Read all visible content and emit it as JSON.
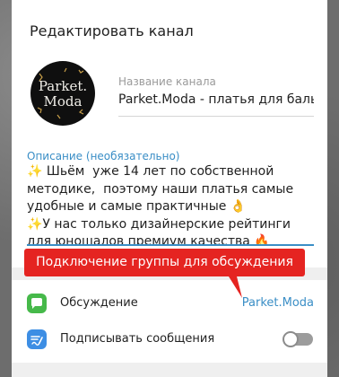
{
  "dialog": {
    "title": "Редактировать канал"
  },
  "channel": {
    "avatar_text_line1": "Parket.",
    "avatar_text_line2": "Moda",
    "name_label": "Название канала",
    "name_value": "Parket.Moda - платья для бальн"
  },
  "description": {
    "label": "Описание (необязательно)",
    "text": "✨ Шьём  уже 14 лет по собственной методике,  поэтому наши платья самые удобные и самые практичные 👌\n✨У нас только дизайнерские рейтинги для юношалов премиум качества 🔥"
  },
  "annotation": {
    "callout_text": "Подключение группы для обсуждения",
    "color": "#e52421"
  },
  "settings": {
    "discussion": {
      "label": "Обсуждение",
      "value": "Parket.Moda",
      "icon": "chat-bubble-icon",
      "icon_color": "#46b94a"
    },
    "sign_messages": {
      "label": "Подписывать сообщения",
      "icon": "signature-icon",
      "icon_color": "#3d8ee4",
      "enabled": false
    }
  },
  "colors": {
    "accent": "#3a8ec6"
  }
}
